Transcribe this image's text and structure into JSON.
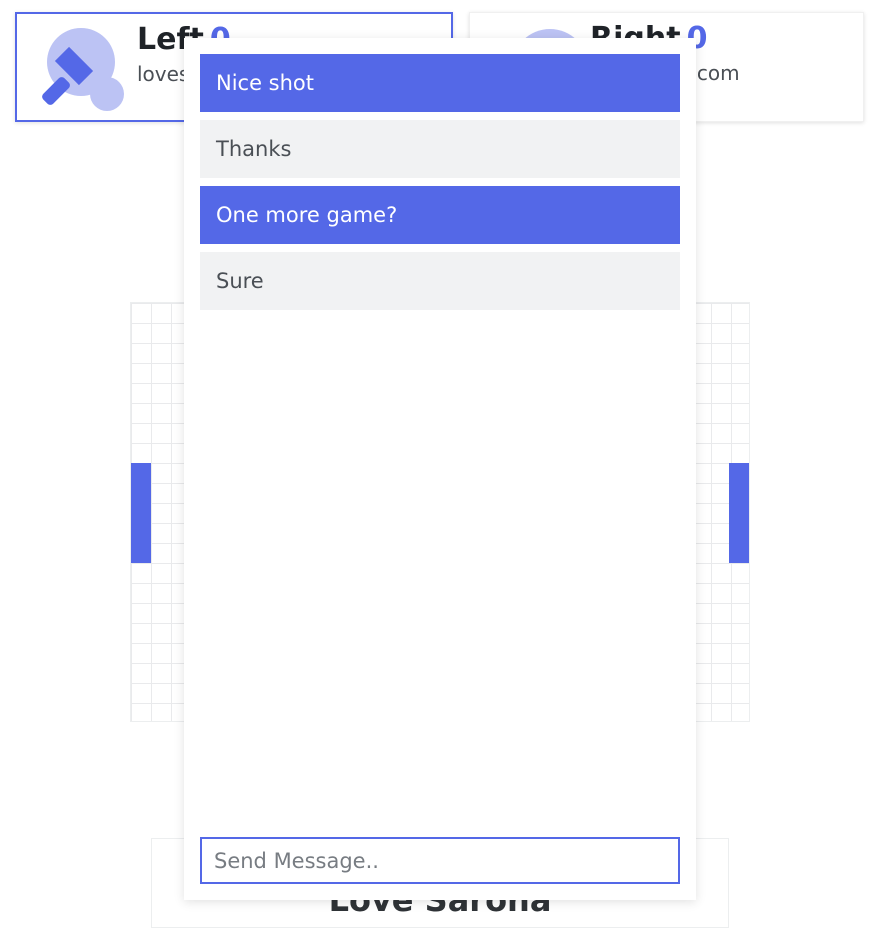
{
  "players": {
    "left": {
      "name": "Left",
      "score": "0",
      "email": "loves"
    },
    "right": {
      "name": "Right",
      "score": "0",
      "email": "na@gmail.com"
    }
  },
  "bottom": {
    "title": "Love Sarona"
  },
  "chat": {
    "messages": [
      {
        "text": "Nice shot",
        "sender": "me"
      },
      {
        "text": "Thanks",
        "sender": "other"
      },
      {
        "text": "One more game?",
        "sender": "me"
      },
      {
        "text": "Sure",
        "sender": "other"
      }
    ],
    "input_placeholder": "Send Message..",
    "input_value": ""
  },
  "icons": {
    "left_avatar": "ping-pong-icon",
    "right_avatar": "user-avatar-icon"
  },
  "colors": {
    "accent": "#5468e7",
    "accent_light": "#bcc3f4",
    "bubble_other": "#f1f2f3"
  }
}
